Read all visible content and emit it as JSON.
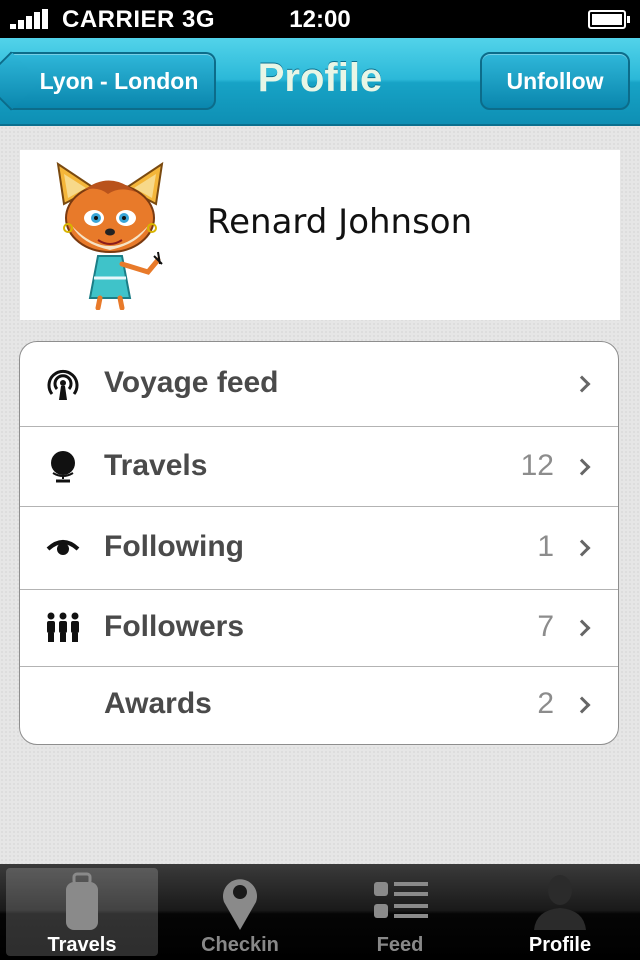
{
  "status_bar": {
    "carrier": "CARRIER 3G",
    "time": "12:00"
  },
  "nav": {
    "back_label": "Lyon - London",
    "title": "Profile",
    "action_label": "Unfollow"
  },
  "profile": {
    "name": "Renard Johnson",
    "avatar": "fox-avatar"
  },
  "menu": {
    "items": [
      {
        "label": "Voyage feed",
        "count": "",
        "icon": "broadcast-icon"
      },
      {
        "label": "Travels",
        "count": "12",
        "icon": "globe-icon"
      },
      {
        "label": "Following",
        "count": "1",
        "icon": "eye-icon"
      },
      {
        "label": "Followers",
        "count": "7",
        "icon": "people-icon"
      },
      {
        "label": "Awards",
        "count": "2",
        "icon": ""
      }
    ]
  },
  "tabs": [
    {
      "label": "Travels",
      "icon": "luggage-icon",
      "active": true
    },
    {
      "label": "Checkin",
      "icon": "map-pin-icon",
      "active": false
    },
    {
      "label": "Feed",
      "icon": "list-icon",
      "active": false
    },
    {
      "label": "Profile",
      "icon": "person-icon",
      "active": false
    }
  ],
  "colors": {
    "nav_accent": "#1fafd2",
    "tab_bar": "#111111",
    "label_text": "#4a4a4a",
    "count_text": "#8c8c8c"
  }
}
